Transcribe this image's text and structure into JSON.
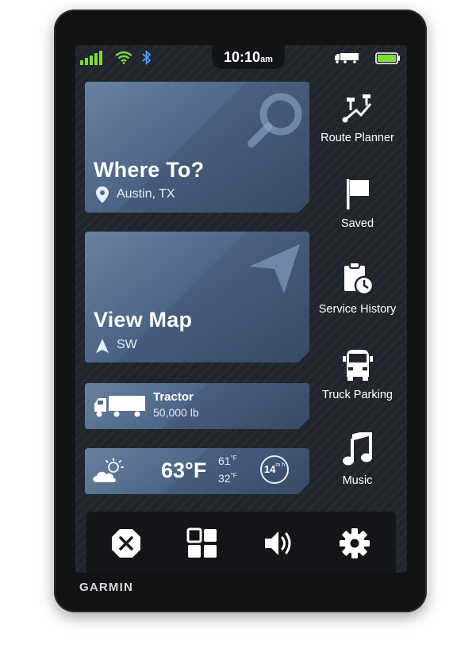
{
  "device": {
    "brand": "GARMIN"
  },
  "status_bar": {
    "time": "10:10",
    "ampm": "am",
    "icons": [
      "signal-icon",
      "wifi-icon",
      "bluetooth-icon",
      "truck-icon",
      "battery-icon"
    ],
    "battery_color": "#7ddc3a"
  },
  "where_to": {
    "title": "Where To?",
    "location": "Austin, TX"
  },
  "view_map": {
    "title": "View Map",
    "heading": "SW"
  },
  "vehicle": {
    "name": "Tractor",
    "weight": "50,000 lb"
  },
  "weather": {
    "temp": "63°F",
    "high": "61",
    "high_unit": "°F",
    "low": "32",
    "low_unit": "°F",
    "forecast_time": "14",
    "forecast_unit": "m h"
  },
  "sidebar": {
    "items": [
      {
        "label": "Route Planner",
        "icon": "route-planner-icon"
      },
      {
        "label": "Saved",
        "icon": "flag-icon"
      },
      {
        "label": "Service History",
        "icon": "service-history-icon"
      },
      {
        "label": "Truck Parking",
        "icon": "truck-parking-icon"
      },
      {
        "label": "Music",
        "icon": "music-icon"
      }
    ]
  },
  "bottom_bar": {
    "buttons": [
      "close-icon",
      "apps-icon",
      "volume-icon",
      "settings-icon"
    ]
  }
}
